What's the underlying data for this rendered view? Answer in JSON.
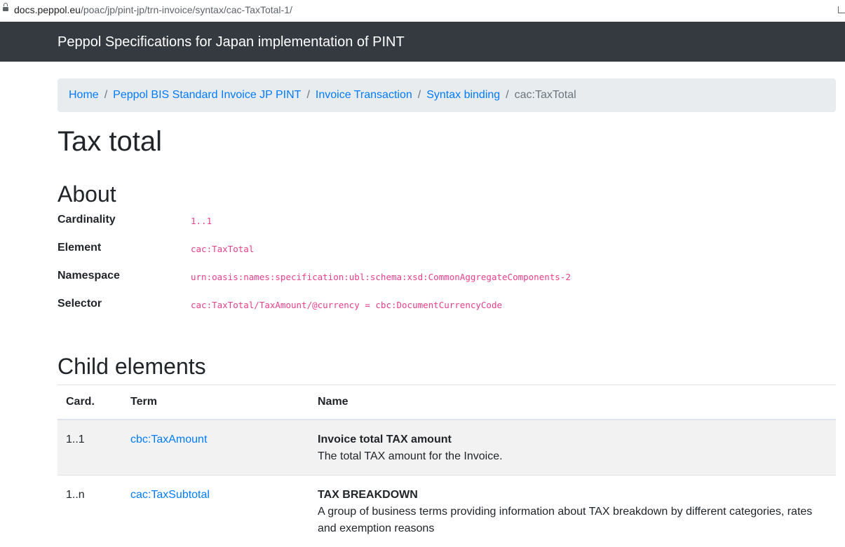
{
  "browser": {
    "url_host": "docs.peppol.eu",
    "url_path": "/poac/jp/pint-jp/trn-invoice/syntax/cac-TaxTotal-1/"
  },
  "navbar": {
    "brand": "Peppol Specifications for Japan implementation of PINT"
  },
  "breadcrumb": {
    "items": [
      "Home",
      "Peppol BIS Standard Invoice JP PINT",
      "Invoice Transaction",
      "Syntax binding"
    ],
    "separator": "/",
    "current": "cac:TaxTotal"
  },
  "page": {
    "title": "Tax total"
  },
  "about": {
    "heading": "About",
    "rows": [
      {
        "label": "Cardinality",
        "value": "1..1"
      },
      {
        "label": "Element",
        "value": "cac:TaxTotal"
      },
      {
        "label": "Namespace",
        "value": "urn:oasis:names:specification:ubl:schema:xsd:CommonAggregateComponents-2"
      },
      {
        "label": "Selector",
        "value": "cac:TaxTotal/TaxAmount/@currency = cbc:DocumentCurrencyCode"
      }
    ]
  },
  "children": {
    "heading": "Child elements",
    "headers": [
      "Card.",
      "Term",
      "Name"
    ],
    "rows": [
      {
        "card": "1..1",
        "term": "cbc:TaxAmount",
        "name": "Invoice total TAX amount",
        "desc": "The total TAX amount for the Invoice."
      },
      {
        "card": "1..n",
        "term": "cac:TaxSubtotal",
        "name": "TAX BREAKDOWN",
        "desc": "A group of business terms providing information about TAX breakdown by different categories, rates and exemption reasons"
      }
    ]
  }
}
